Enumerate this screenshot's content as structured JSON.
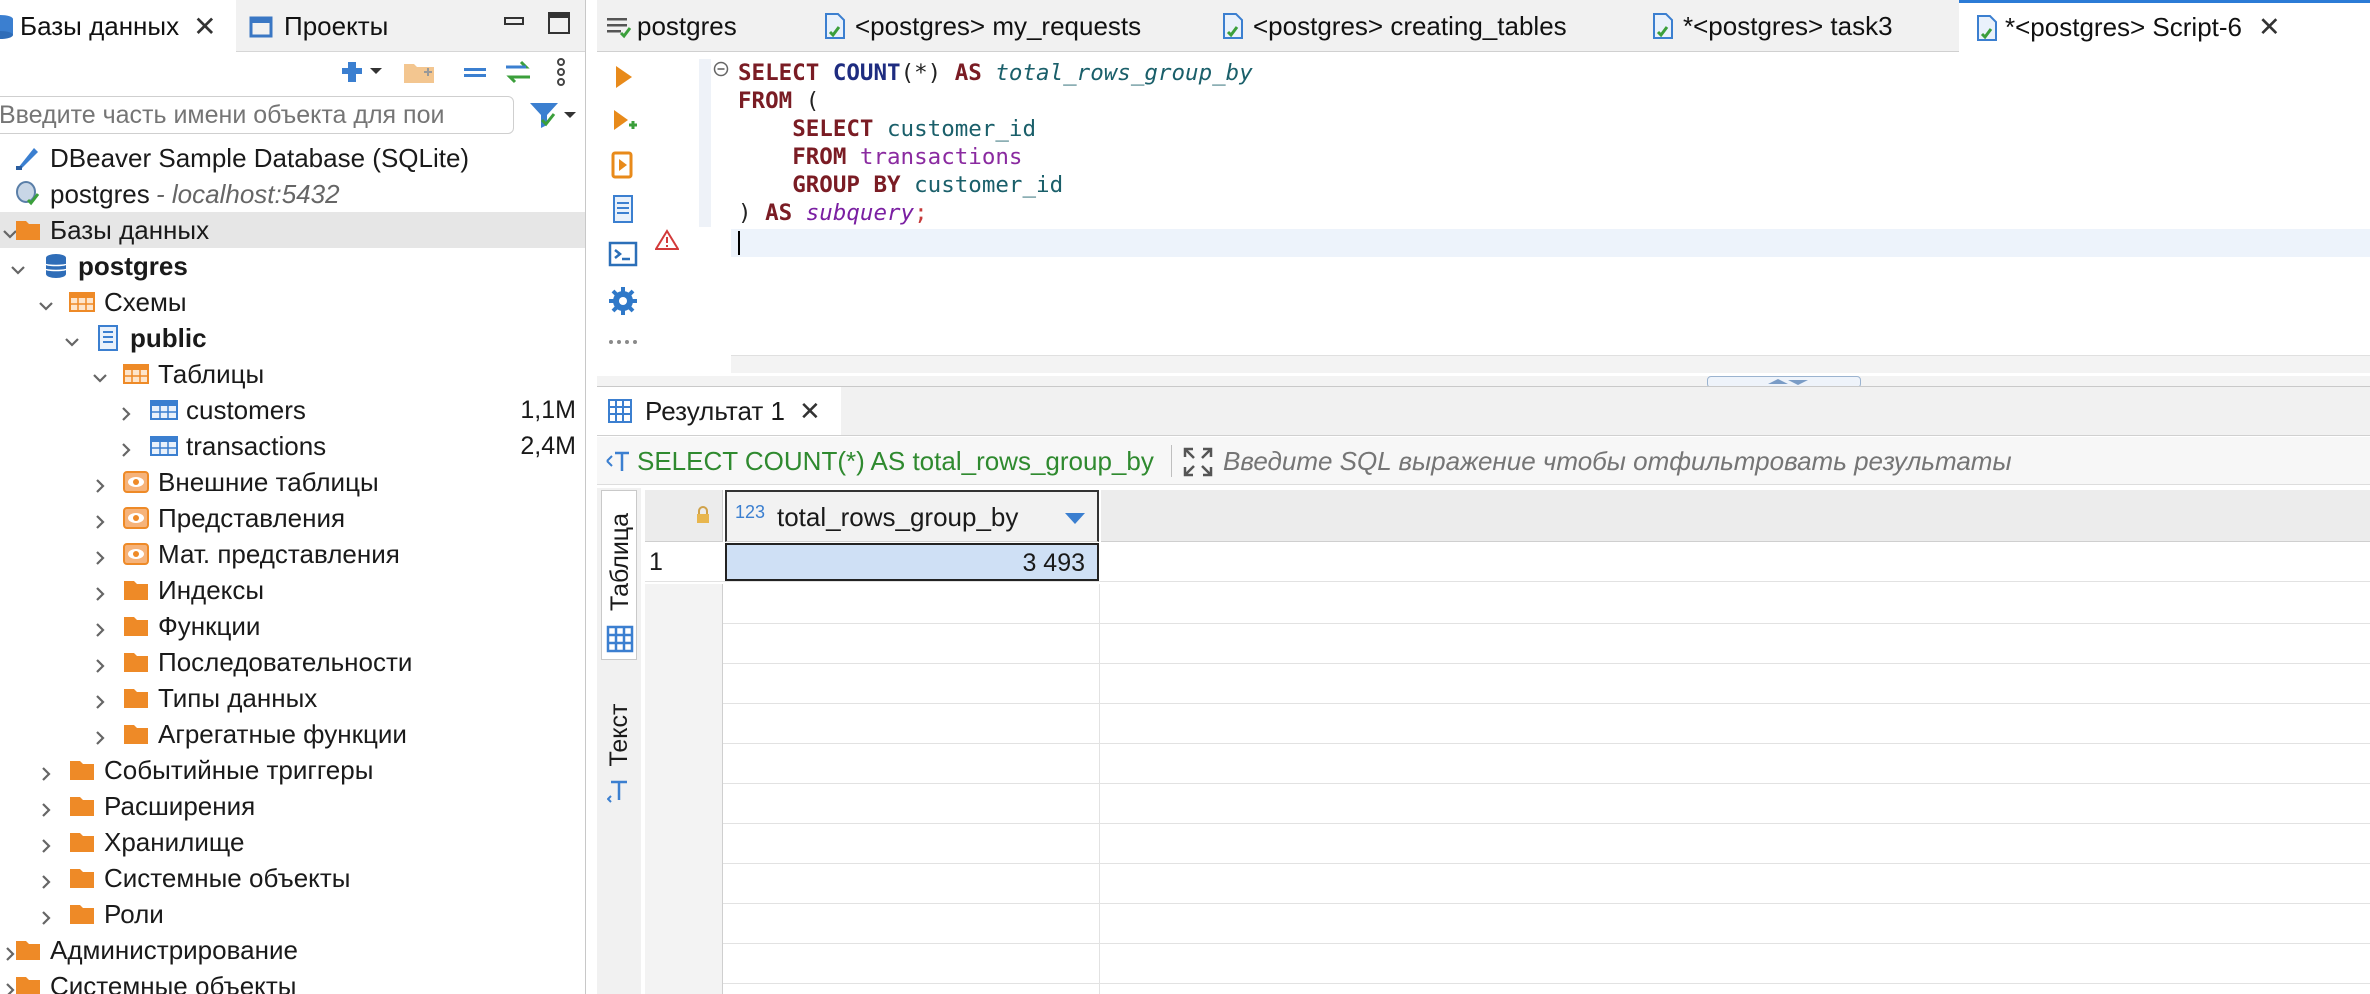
{
  "left_panel": {
    "tabs": [
      {
        "label": "Базы данных",
        "icon": "database-icon"
      },
      {
        "label": "Проекты",
        "icon": "projects-icon"
      }
    ],
    "search_placeholder": "Введите часть имени объекта для пои",
    "tree": [
      {
        "label": "DBeaver Sample Database (SQLite)",
        "icon": "sqlite-icon",
        "level": 0
      },
      {
        "label": "postgres",
        "suffix": " - localhost:5432",
        "icon": "postgres-icon",
        "level": 0
      },
      {
        "label": "Базы данных",
        "icon": "folder-databases-icon",
        "level": 1
      },
      {
        "label": "postgres",
        "icon": "database-icon",
        "level": 2
      },
      {
        "label": "Схемы",
        "icon": "schemas-icon",
        "level": 3
      },
      {
        "label": "public",
        "icon": "schema-icon",
        "level": 4
      },
      {
        "label": "Таблицы",
        "icon": "tables-icon",
        "level": 5
      },
      {
        "label": "customers",
        "icon": "table-icon",
        "size": "1,1M",
        "level": 6
      },
      {
        "label": "transactions",
        "icon": "table-icon",
        "size": "2,4M",
        "level": 6
      },
      {
        "label": "Внешние таблицы",
        "icon": "foreign-tables-icon",
        "level": 5
      },
      {
        "label": "Представления",
        "icon": "views-icon",
        "level": 5
      },
      {
        "label": "Мат. представления",
        "icon": "mat-views-icon",
        "level": 5
      },
      {
        "label": "Индексы",
        "icon": "folder-icon",
        "level": 5
      },
      {
        "label": "Функции",
        "icon": "folder-icon",
        "level": 5
      },
      {
        "label": "Последовательности",
        "icon": "folder-icon",
        "level": 5
      },
      {
        "label": "Типы данных",
        "icon": "folder-icon",
        "level": 5
      },
      {
        "label": "Агрегатные функции",
        "icon": "folder-icon",
        "level": 5
      },
      {
        "label": "Событийные триггеры",
        "icon": "folder-icon",
        "level": 3
      },
      {
        "label": "Расширения",
        "icon": "extensions-icon",
        "level": 3
      },
      {
        "label": "Хранилище",
        "icon": "storage-icon",
        "level": 3
      },
      {
        "label": "Системные объекты",
        "icon": "system-objects-icon",
        "level": 3
      },
      {
        "label": "Роли",
        "icon": "roles-icon",
        "level": 3
      },
      {
        "label": "Администрирование",
        "icon": "admin-icon",
        "level": 1
      },
      {
        "label": "Системные объекты",
        "icon": "system-objects-icon",
        "level": 1
      }
    ]
  },
  "editor_tabs": [
    {
      "label": "postgres",
      "icon": "sql-console-icon"
    },
    {
      "label": "<postgres> my_requests",
      "icon": "sql-script-icon"
    },
    {
      "label": "<postgres> creating_tables",
      "icon": "sql-script-icon"
    },
    {
      "label": "*<postgres> task3",
      "icon": "sql-script-icon"
    },
    {
      "label": "*<postgres> Script-6",
      "icon": "sql-script-icon",
      "active": true
    }
  ],
  "code": {
    "l1": [
      "SELECT",
      "COUNT",
      "(*)",
      "AS",
      "total_rows_group_by"
    ],
    "l2": [
      "FROM",
      "("
    ],
    "l3": [
      "SELECT",
      "customer_id"
    ],
    "l4": [
      "FROM",
      "transactions"
    ],
    "l5": [
      "GROUP BY",
      "customer_id"
    ],
    "l6": [
      ")",
      "AS",
      "subquery",
      ";"
    ]
  },
  "results": {
    "tab_label": "Результат 1",
    "query_text": "SELECT COUNT(*) AS total_rows_group_by",
    "filter_placeholder": "Введите SQL выражение чтобы отфильтровать результаты",
    "vertical_tabs": [
      "Таблица",
      "Текст"
    ],
    "column_type": "123",
    "columns": [
      "total_rows_group_by"
    ],
    "rows": [
      {
        "num": "1",
        "value": "3 493"
      }
    ]
  }
}
